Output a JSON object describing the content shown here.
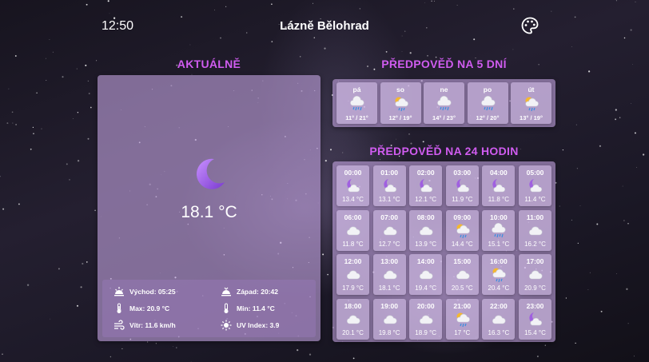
{
  "header": {
    "time": "12:50",
    "city": "Lázně Bělohrad",
    "palette_icon": "palette-icon"
  },
  "current": {
    "title": "AKTUÁLNĚ",
    "icon": "moon-icon",
    "temperature": "18.1 °C",
    "details": {
      "sunrise": "Východ: 05:25",
      "sunset": "Západ: 20:42",
      "max": "Max: 20.9 °C",
      "min": "Min: 11.4 °C",
      "wind": "Vítr: 11.6 km/h",
      "uv": "UV Index: 3.9"
    }
  },
  "forecast5": {
    "title": "PŘEDPOVĚĎ NA 5 DNÍ",
    "days": [
      {
        "day": "pá",
        "range": "11° / 21°",
        "icon": "cloud-rain-icon"
      },
      {
        "day": "so",
        "range": "12° / 19°",
        "icon": "sun-cloud-rain-icon"
      },
      {
        "day": "ne",
        "range": "14° / 23°",
        "icon": "cloud-rain-icon"
      },
      {
        "day": "po",
        "range": "12° / 20°",
        "icon": "cloud-rain-icon"
      },
      {
        "day": "út",
        "range": "13° / 19°",
        "icon": "sun-cloud-rain-icon"
      }
    ]
  },
  "forecast24": {
    "title": "PŘEDPOVĚĎ NA 24 HODIN",
    "hours": [
      {
        "time": "00:00",
        "temp": "13.4 °C",
        "icon": "moon-cloud-icon"
      },
      {
        "time": "01:00",
        "temp": "13.1 °C",
        "icon": "moon-cloud-icon"
      },
      {
        "time": "02:00",
        "temp": "12.1 °C",
        "icon": "moon-cloud-icon"
      },
      {
        "time": "03:00",
        "temp": "11.9 °C",
        "icon": "moon-cloud-icon"
      },
      {
        "time": "04:00",
        "temp": "11.8 °C",
        "icon": "moon-cloud-icon"
      },
      {
        "time": "05:00",
        "temp": "11.4 °C",
        "icon": "moon-cloud-icon"
      },
      {
        "time": "06:00",
        "temp": "11.8 °C",
        "icon": "cloud-icon"
      },
      {
        "time": "07:00",
        "temp": "12.7 °C",
        "icon": "cloud-icon"
      },
      {
        "time": "08:00",
        "temp": "13.9 °C",
        "icon": "cloud-icon"
      },
      {
        "time": "09:00",
        "temp": "14.4 °C",
        "icon": "sun-cloud-rain-icon"
      },
      {
        "time": "10:00",
        "temp": "15.1 °C",
        "icon": "cloud-rain-icon"
      },
      {
        "time": "11:00",
        "temp": "16.2 °C",
        "icon": "cloud-icon"
      },
      {
        "time": "12:00",
        "temp": "17.9 °C",
        "icon": "cloud-icon"
      },
      {
        "time": "13:00",
        "temp": "18.1 °C",
        "icon": "cloud-icon"
      },
      {
        "time": "14:00",
        "temp": "19.4 °C",
        "icon": "cloud-icon"
      },
      {
        "time": "15:00",
        "temp": "20.5 °C",
        "icon": "cloud-icon"
      },
      {
        "time": "16:00",
        "temp": "20.4 °C",
        "icon": "sun-cloud-rain-icon"
      },
      {
        "time": "17:00",
        "temp": "20.9 °C",
        "icon": "cloud-icon"
      },
      {
        "time": "18:00",
        "temp": "20.1 °C",
        "icon": "cloud-icon"
      },
      {
        "time": "19:00",
        "temp": "19.8 °C",
        "icon": "cloud-icon"
      },
      {
        "time": "20:00",
        "temp": "18.9 °C",
        "icon": "cloud-icon"
      },
      {
        "time": "21:00",
        "temp": "17 °C",
        "icon": "sun-cloud-rain-icon"
      },
      {
        "time": "22:00",
        "temp": "16.3 °C",
        "icon": "cloud-icon"
      },
      {
        "time": "23:00",
        "temp": "15.4 °C",
        "icon": "moon-cloud-icon"
      }
    ]
  },
  "colors": {
    "accent": "#d05cf0",
    "card": "#be a0dc",
    "moon": "#a060e0"
  }
}
